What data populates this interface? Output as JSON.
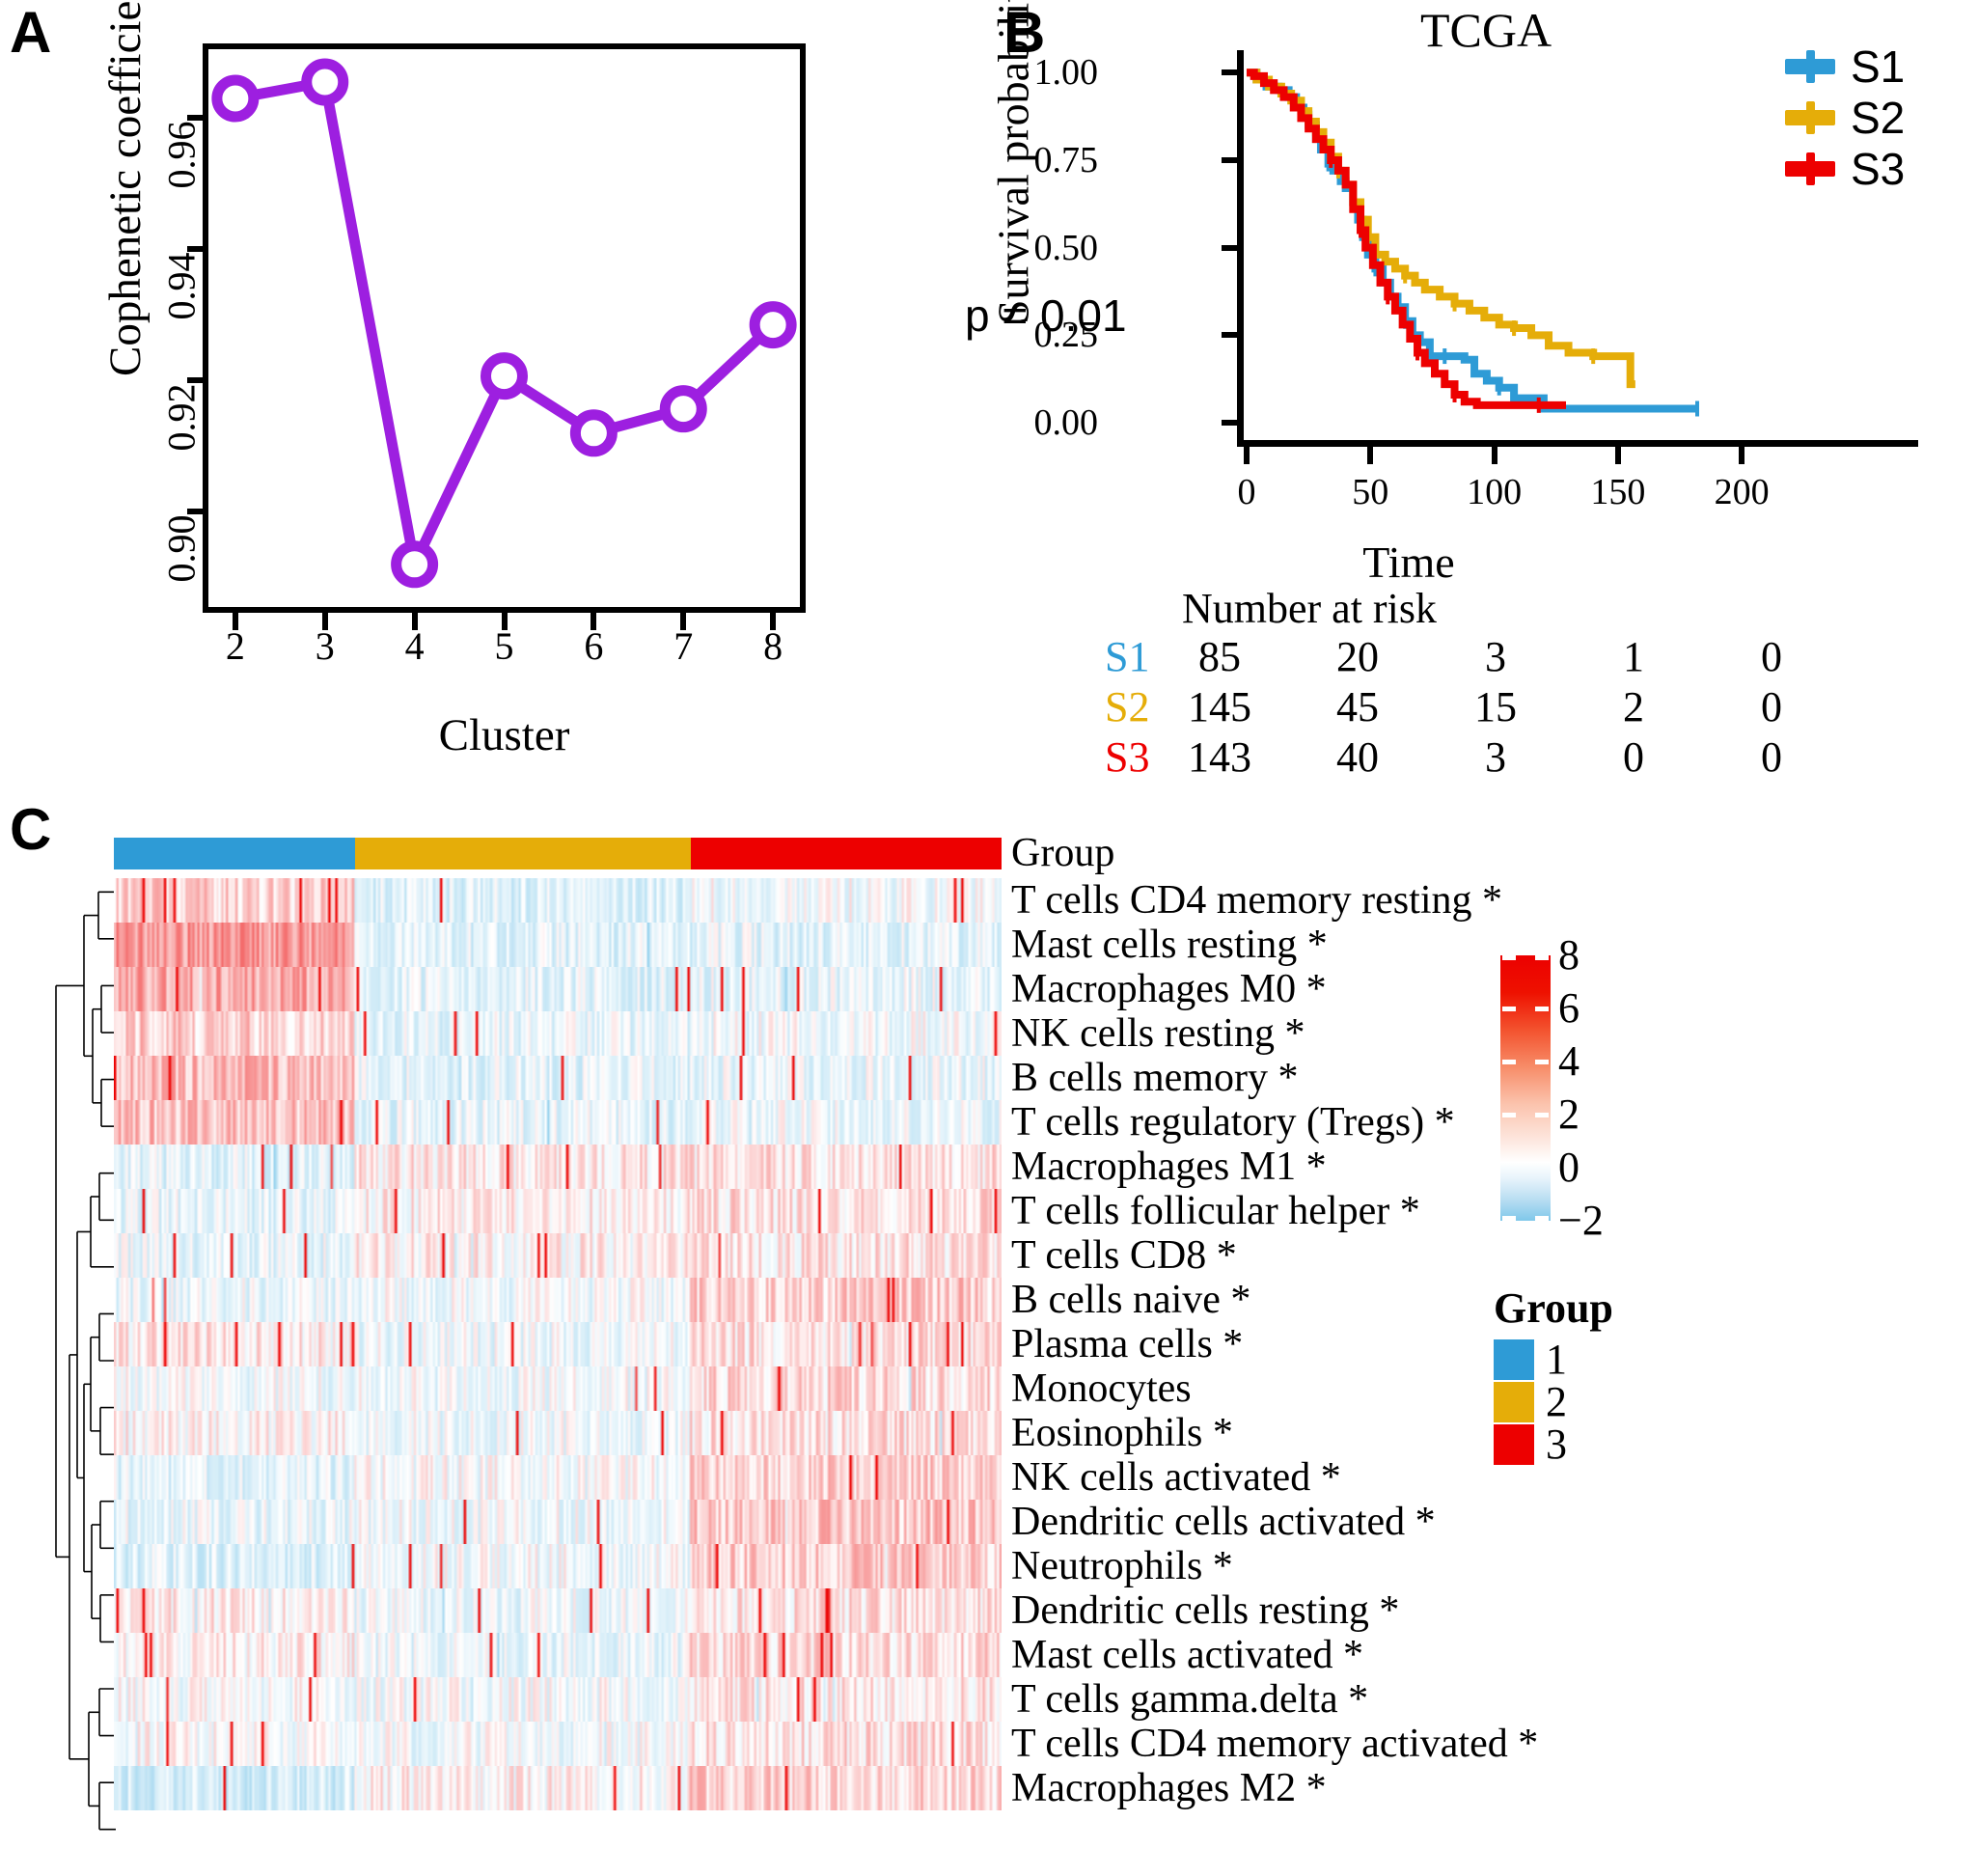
{
  "panels": {
    "a_letter": "A",
    "b_letter": "B",
    "c_letter": "C"
  },
  "panel_a": {
    "ylabel": "Cophenetic coefficient",
    "xlabel": "Cluster"
  },
  "panel_b": {
    "title": "TCGA",
    "ylabel": "Survival probability",
    "xlabel": "Time",
    "pvalue": "p = 0.01",
    "risk_title": "Number at risk",
    "legend": [
      {
        "label": "S1",
        "color": "#2E9BD6"
      },
      {
        "label": "S2",
        "color": "#E5AD09"
      },
      {
        "label": "S3",
        "color": "#ED0000"
      }
    ],
    "risk_rows": [
      {
        "label": "S1",
        "color": "#2E9BD6",
        "values": [
          "85",
          "20",
          "3",
          "1",
          "0"
        ]
      },
      {
        "label": "S2",
        "color": "#E5AD09",
        "values": [
          "145",
          "45",
          "15",
          "2",
          "0"
        ]
      },
      {
        "label": "S3",
        "color": "#ED0000",
        "values": [
          "143",
          "40",
          "3",
          "0",
          "0"
        ]
      }
    ]
  },
  "panel_c": {
    "group_label": "Group",
    "group_segments": [
      {
        "group": "1",
        "color": "#2E9BD6",
        "fraction": 0.272
      },
      {
        "group": "2",
        "color": "#E5AD09",
        "fraction": 0.378
      },
      {
        "group": "3",
        "color": "#ED0000",
        "fraction": 0.35
      }
    ],
    "row_labels": [
      "T cells CD4 memory resting *",
      "Mast cells resting  *",
      "Macrophages M0  *",
      "NK cells resting   *",
      "B cells memory   *",
      "T cells regulatory (Tregs) *",
      "Macrophages M1  *",
      "T cells follicular helper *",
      "T cells CD8   *",
      "B cells naive  *",
      "Plasma cells   *",
      "Monocytes",
      "Eosinophils  *",
      "NK cells activated *",
      "Dendritic cells activated *",
      "Neutrophils  *",
      "Dendritic cells resting  *",
      "Mast cells activated  *",
      "T cells gamma.delta *",
      "T cells CD4 memory activated *",
      "Macrophages M2 *"
    ],
    "colorbar": {
      "ticks": [
        "8",
        "6",
        "4",
        "2",
        "0",
        "−2"
      ],
      "min": -2,
      "max": 8,
      "low_color": "#7FC8EA",
      "mid_color": "#FFFFFF",
      "high_color": "#EC0000"
    },
    "group_legend": {
      "title": "Group",
      "items": [
        {
          "label": "1",
          "color": "#2E9BD6"
        },
        {
          "label": "2",
          "color": "#E5AD09"
        },
        {
          "label": "3",
          "color": "#ED0000"
        }
      ]
    }
  },
  "chart_data": [
    {
      "type": "line",
      "panel": "A",
      "title": "",
      "xlabel": "Cluster",
      "ylabel": "Cophenetic coefficient",
      "x": [
        2,
        3,
        4,
        5,
        6,
        7,
        8
      ],
      "values": [
        0.963,
        0.9655,
        0.892,
        0.9207,
        0.912,
        0.9157,
        0.9285
      ],
      "categories": [
        "2",
        "3",
        "4",
        "5",
        "6",
        "7",
        "8"
      ],
      "xticks": [
        "2",
        "3",
        "4",
        "5",
        "6",
        "7",
        "8"
      ],
      "yticks": [
        "0.90",
        "0.92",
        "0.94",
        "0.96"
      ],
      "ytick_values": [
        0.9,
        0.92,
        0.94,
        0.96
      ],
      "ylim": [
        0.8855,
        0.9705
      ],
      "xlim": [
        1.7,
        8.3
      ],
      "line_color": "#9D1FE0",
      "marker": "open-circle",
      "grid": false,
      "legend": "none"
    },
    {
      "type": "line",
      "panel": "B",
      "subtype": "kaplan-meier",
      "title": "TCGA",
      "xlabel": "Time",
      "ylabel": "Survival probability",
      "annotation": "p = 0.01",
      "xlim": [
        0,
        205
      ],
      "ylim": [
        0,
        1.02
      ],
      "xticks": [
        "0",
        "50",
        "100",
        "150",
        "200"
      ],
      "xtick_values": [
        0,
        50,
        100,
        150,
        200
      ],
      "yticks": [
        "0.00",
        "0.25",
        "0.50",
        "0.75",
        "1.00"
      ],
      "ytick_values": [
        0.0,
        0.25,
        0.5,
        0.75,
        1.0
      ],
      "grid": false,
      "legend": "right",
      "series": [
        {
          "name": "S1",
          "color": "#2E9BD6",
          "points": [
            [
              0,
              1.0
            ],
            [
              4,
              0.98
            ],
            [
              8,
              0.96
            ],
            [
              13,
              0.95
            ],
            [
              17,
              0.93
            ],
            [
              20,
              0.9
            ],
            [
              23,
              0.88
            ],
            [
              25,
              0.85
            ],
            [
              28,
              0.81
            ],
            [
              30,
              0.78
            ],
            [
              33,
              0.74
            ],
            [
              35,
              0.72
            ],
            [
              38,
              0.69
            ],
            [
              40,
              0.67
            ],
            [
              43,
              0.63
            ],
            [
              45,
              0.58
            ],
            [
              47,
              0.53
            ],
            [
              49,
              0.48
            ],
            [
              52,
              0.44
            ],
            [
              55,
              0.4
            ],
            [
              58,
              0.36
            ],
            [
              61,
              0.33
            ],
            [
              64,
              0.29
            ],
            [
              67,
              0.25
            ],
            [
              70,
              0.23
            ],
            [
              74,
              0.19
            ],
            [
              80,
              0.19
            ],
            [
              88,
              0.18
            ],
            [
              92,
              0.14
            ],
            [
              97,
              0.12
            ],
            [
              102,
              0.1
            ],
            [
              108,
              0.07
            ],
            [
              120,
              0.04
            ],
            [
              150,
              0.04
            ],
            [
              182,
              0.04
            ]
          ]
        },
        {
          "name": "S2",
          "color": "#E5AD09",
          "points": [
            [
              0,
              1.0
            ],
            [
              4,
              0.98
            ],
            [
              9,
              0.96
            ],
            [
              14,
              0.94
            ],
            [
              18,
              0.92
            ],
            [
              22,
              0.89
            ],
            [
              25,
              0.86
            ],
            [
              28,
              0.83
            ],
            [
              31,
              0.8
            ],
            [
              34,
              0.76
            ],
            [
              37,
              0.72
            ],
            [
              40,
              0.68
            ],
            [
              43,
              0.63
            ],
            [
              46,
              0.58
            ],
            [
              49,
              0.53
            ],
            [
              52,
              0.48
            ],
            [
              56,
              0.46
            ],
            [
              60,
              0.44
            ],
            [
              64,
              0.42
            ],
            [
              68,
              0.4
            ],
            [
              72,
              0.38
            ],
            [
              78,
              0.36
            ],
            [
              84,
              0.34
            ],
            [
              90,
              0.32
            ],
            [
              96,
              0.3
            ],
            [
              102,
              0.28
            ],
            [
              108,
              0.27
            ],
            [
              115,
              0.25
            ],
            [
              122,
              0.22
            ],
            [
              130,
              0.2
            ],
            [
              140,
              0.19
            ],
            [
              152,
              0.19
            ],
            [
              155,
              0.11
            ],
            [
              157,
              0.11
            ]
          ]
        },
        {
          "name": "S3",
          "color": "#ED0000",
          "points": [
            [
              0,
              1.0
            ],
            [
              3,
              0.99
            ],
            [
              7,
              0.97
            ],
            [
              11,
              0.95
            ],
            [
              15,
              0.93
            ],
            [
              19,
              0.9
            ],
            [
              22,
              0.87
            ],
            [
              25,
              0.84
            ],
            [
              28,
              0.81
            ],
            [
              31,
              0.78
            ],
            [
              34,
              0.75
            ],
            [
              37,
              0.72
            ],
            [
              40,
              0.68
            ],
            [
              43,
              0.61
            ],
            [
              46,
              0.55
            ],
            [
              48,
              0.5
            ],
            [
              51,
              0.45
            ],
            [
              54,
              0.4
            ],
            [
              57,
              0.36
            ],
            [
              60,
              0.32
            ],
            [
              63,
              0.28
            ],
            [
              66,
              0.24
            ],
            [
              69,
              0.2
            ],
            [
              72,
              0.17
            ],
            [
              76,
              0.14
            ],
            [
              80,
              0.11
            ],
            [
              84,
              0.08
            ],
            [
              88,
              0.06
            ],
            [
              93,
              0.05
            ],
            [
              105,
              0.05
            ],
            [
              118,
              0.05
            ],
            [
              129,
              0.05
            ]
          ]
        }
      ]
    },
    {
      "type": "heatmap",
      "panel": "C",
      "title": "",
      "row_count": 21,
      "column_count": 373,
      "value_range": [
        -2,
        8
      ],
      "column_annotation": "Group",
      "column_groups": [
        "1",
        "2",
        "3"
      ],
      "colormap": "blue-white-red",
      "row_dendrogram": true,
      "rows": [
        "T cells CD4 memory resting *",
        "Mast cells resting  *",
        "Macrophages M0  *",
        "NK cells resting   *",
        "B cells memory   *",
        "T cells regulatory (Tregs) *",
        "Macrophages M1  *",
        "T cells follicular helper *",
        "T cells CD8   *",
        "B cells naive  *",
        "Plasma cells   *",
        "Monocytes",
        "Eosinophils  *",
        "NK cells activated *",
        "Dendritic cells activated *",
        "Neutrophils  *",
        "Dendritic cells resting  *",
        "Mast cells activated  *",
        "T cells gamma.delta *",
        "T cells CD4 memory activated *",
        "Macrophages M2 *"
      ]
    }
  ]
}
